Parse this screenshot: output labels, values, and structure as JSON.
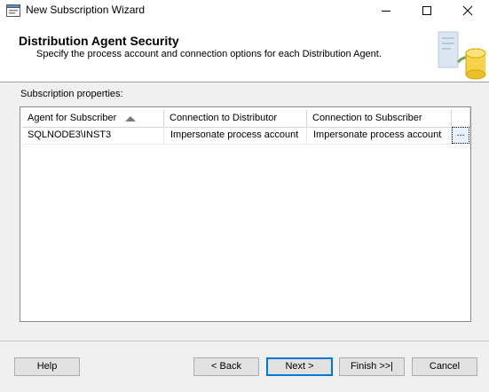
{
  "window": {
    "title": "New Subscription Wizard",
    "icon": "wizard-app-icon",
    "controls": [
      "minimize-icon",
      "maximize-icon",
      "close-icon"
    ]
  },
  "header": {
    "title": "Distribution Agent Security",
    "subtitle": "Specify the process account and connection options for each Distribution Agent.",
    "logo": "database-sync-icon"
  },
  "section": {
    "label": "Subscription properties:"
  },
  "grid": {
    "columns": [
      "Agent for Subscriber",
      "Connection to Distributor",
      "Connection to Subscriber"
    ],
    "sort_column": "Agent for Subscriber",
    "sort_direction": "ascending",
    "rows": [
      {
        "agent": "SQLNODE3\\INST3",
        "distributor": "Impersonate process account",
        "subscriber": "Impersonate process account",
        "action": "..."
      }
    ]
  },
  "buttons": {
    "help": "Help",
    "back": "< Back",
    "next": "Next >",
    "finish": "Finish >>|",
    "cancel": "Cancel"
  },
  "colors": {
    "accent": "#0078d7",
    "selected_cell": "#e7f1fb",
    "window_bg": "#f0f0f0"
  }
}
